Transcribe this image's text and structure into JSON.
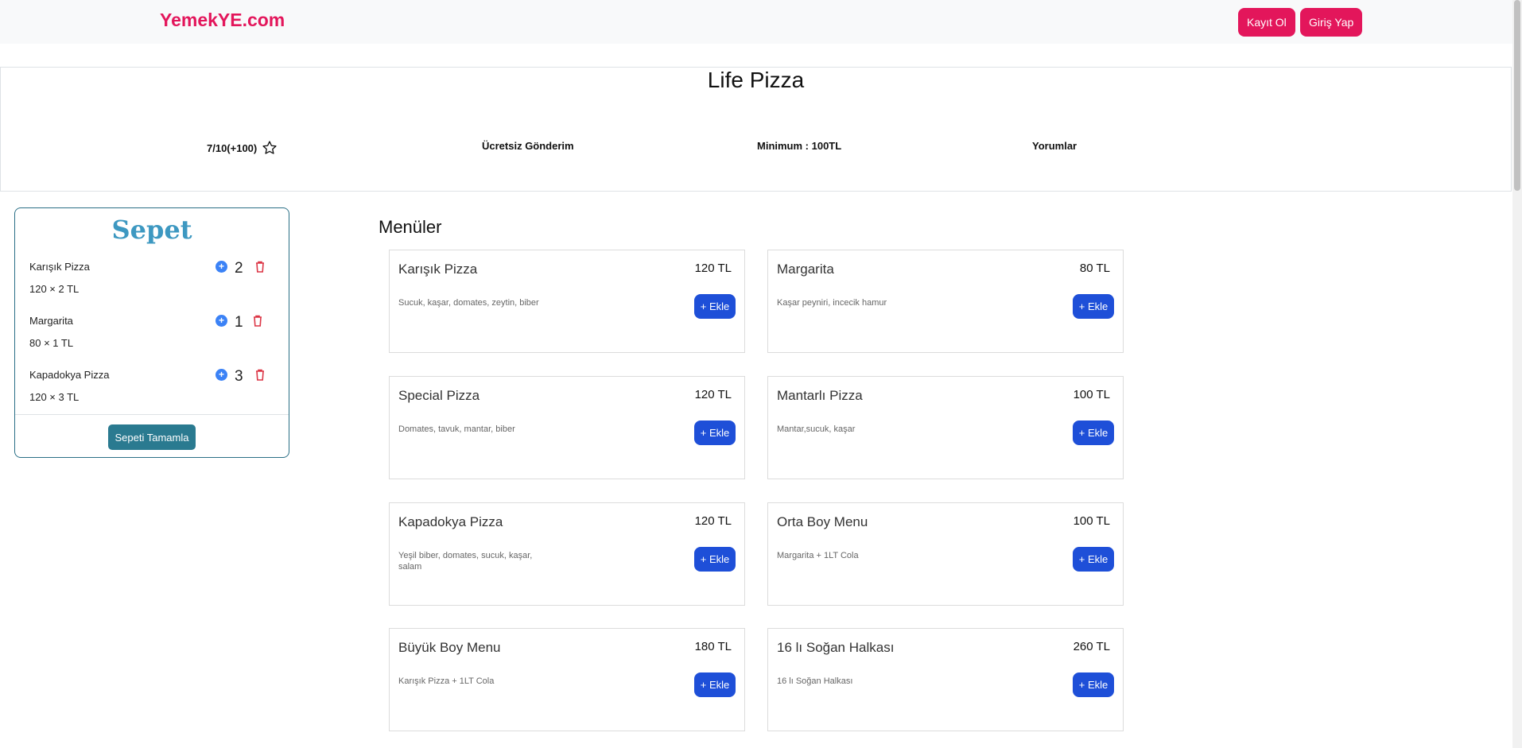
{
  "navbar": {
    "brand": "YemekYE.com",
    "register_label": "Kayıt Ol",
    "login_label": "Giriş Yap"
  },
  "restaurant": {
    "name": "Life Pizza",
    "rating": "7/10(+100)",
    "delivery": "Ücretsiz Gönderim",
    "minimum": "Minimum : 100TL",
    "reviews": "Yorumlar"
  },
  "cart": {
    "title": "Sepet",
    "items": [
      {
        "name": "Karışık Pizza",
        "qty": "2",
        "subtotal": "120 × 2 TL"
      },
      {
        "name": "Margarita",
        "qty": "1",
        "subtotal": "80 × 1 TL"
      },
      {
        "name": "Kapadokya Pizza",
        "qty": "3",
        "subtotal": "120 × 3 TL"
      }
    ],
    "checkout_label": "Sepeti Tamamla"
  },
  "menu": {
    "title": "Menüler",
    "add_label": "+ Ekle",
    "items": [
      {
        "name": "Karışık Pizza",
        "price": "120 TL",
        "desc": "Sucuk, kaşar, domates, zeytin, biber"
      },
      {
        "name": "Margarita",
        "price": "80 TL",
        "desc": "Kaşar peyniri, incecik hamur"
      },
      {
        "name": "Special Pizza",
        "price": "120 TL",
        "desc": "Domates, tavuk, mantar, biber"
      },
      {
        "name": "Mantarlı Pizza",
        "price": "100 TL",
        "desc": "Mantar,sucuk, kaşar"
      },
      {
        "name": "Kapadokya Pizza",
        "price": "120 TL",
        "desc": "Yeşil biber, domates, sucuk, kaşar, salam"
      },
      {
        "name": "Orta Boy Menu",
        "price": "100 TL",
        "desc": "Margarita + 1LT Cola"
      },
      {
        "name": "Büyük Boy Menu",
        "price": "180 TL",
        "desc": "Karışık Pizza + 1LT Cola"
      },
      {
        "name": "16 lı Soğan Halkası",
        "price": "260 TL",
        "desc": "16 lı Soğan Halkası"
      }
    ]
  },
  "colors": {
    "brand": "#e3165b",
    "add_button": "#1e4fd8",
    "checkout_button": "#2a7a90",
    "cart_title": "#3d98c1",
    "trash": "#dc3545"
  }
}
